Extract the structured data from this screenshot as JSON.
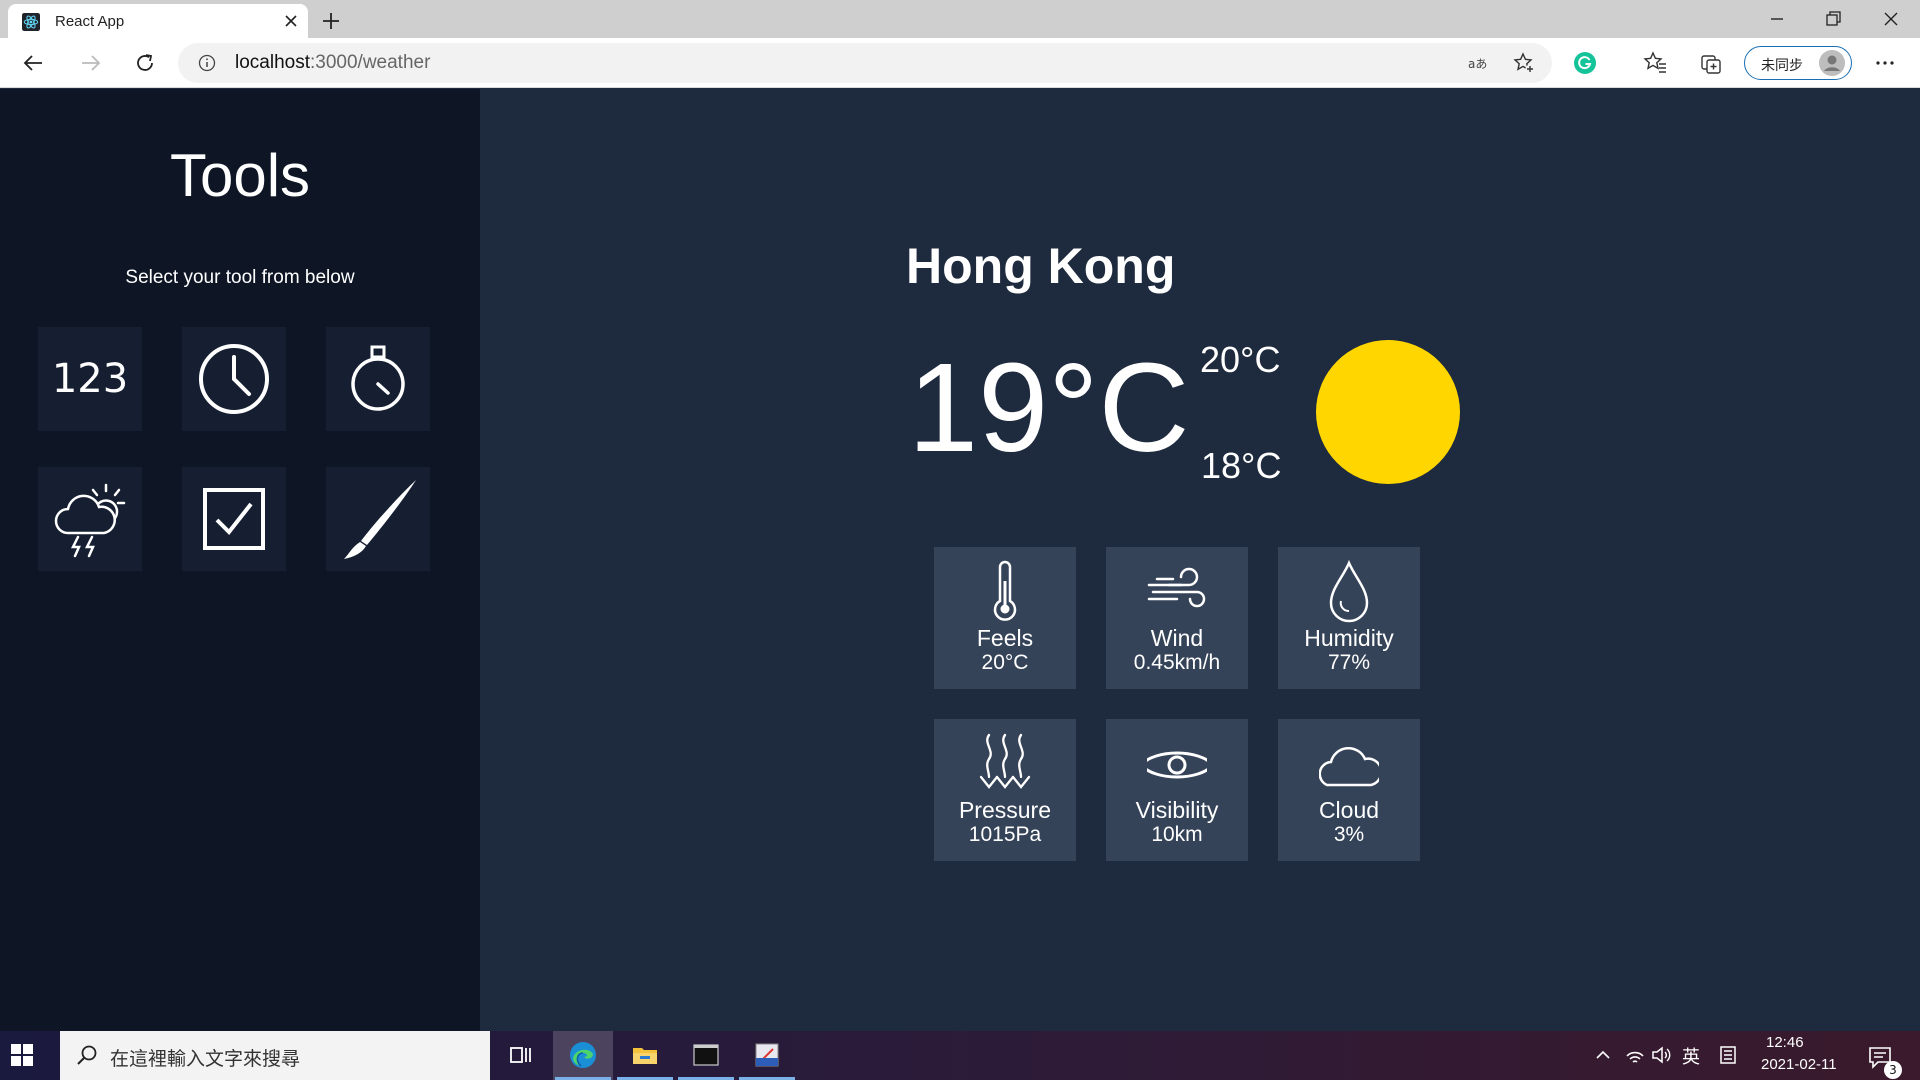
{
  "browser": {
    "tab_title": "React App",
    "address": {
      "host": "localhost",
      "path": ":3000/weather"
    },
    "profile_label": "未同步"
  },
  "sidebar": {
    "title": "Tools",
    "subtitle": "Select your tool from below",
    "tools": [
      {
        "id": "numbers",
        "text": "123",
        "icon": "numbers-icon"
      },
      {
        "id": "clock",
        "icon": "clock-icon"
      },
      {
        "id": "stopwatch",
        "icon": "stopwatch-icon"
      },
      {
        "id": "weather",
        "icon": "weather-storm-icon"
      },
      {
        "id": "todo",
        "icon": "checkbox-icon"
      },
      {
        "id": "paint",
        "icon": "brush-icon"
      }
    ]
  },
  "weather": {
    "city": "Hong Kong",
    "temp": "19°C",
    "temp_max": "20°C",
    "temp_min": "18°C",
    "condition_icon": "sun-icon",
    "stats": [
      {
        "label": "Feels",
        "value": "20°C",
        "icon": "thermometer-icon"
      },
      {
        "label": "Wind",
        "value": "0.45km/h",
        "icon": "wind-icon"
      },
      {
        "label": "Humidity",
        "value": "77%",
        "icon": "droplet-icon"
      },
      {
        "label": "Pressure",
        "value": "1015Pa",
        "icon": "pressure-icon"
      },
      {
        "label": "Visibility",
        "value": "10km",
        "icon": "eye-icon"
      },
      {
        "label": "Cloud",
        "value": "3%",
        "icon": "cloud-icon"
      }
    ]
  },
  "taskbar": {
    "search_placeholder": "在這裡輸入文字來搜尋",
    "ime": "英",
    "time": "12:46",
    "date": "2021-02-11",
    "notification_count": "3"
  },
  "colors": {
    "sidebar_bg": "#0e1626",
    "main_bg": "#1e2a3d",
    "tile_bg": "#354358",
    "sun": "#ffd600"
  }
}
